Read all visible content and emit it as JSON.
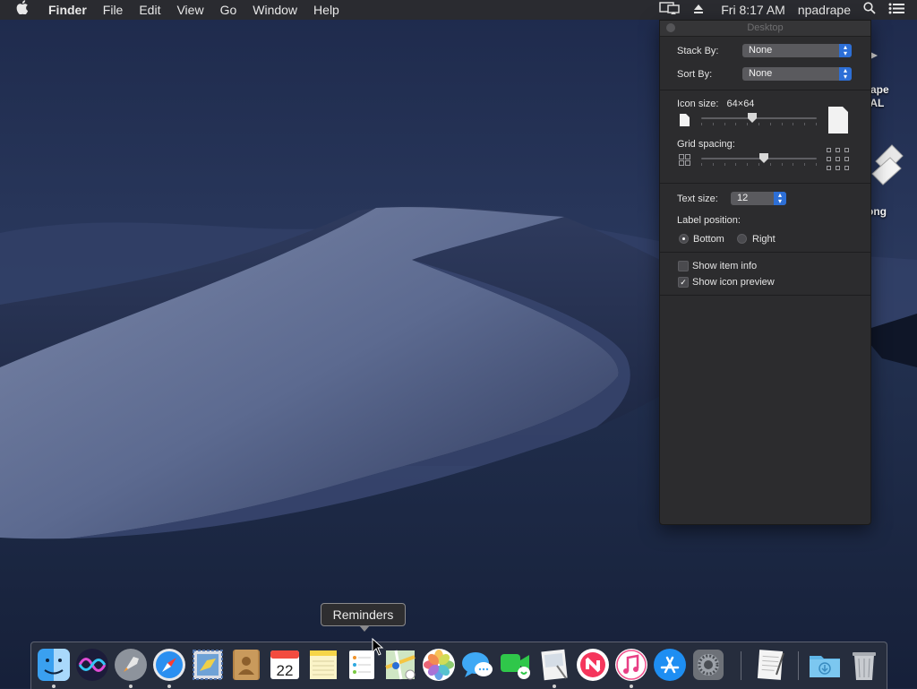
{
  "menubar": {
    "app_name": "Finder",
    "menus": [
      "File",
      "Edit",
      "View",
      "Go",
      "Window",
      "Help"
    ],
    "clock": "Fri 8:17 AM",
    "user": "npadrape"
  },
  "desktop": {
    "label_fragments": [
      "ape",
      "IAL",
      "ong"
    ]
  },
  "view_options": {
    "title": "Desktop",
    "stack_by_label": "Stack By:",
    "stack_by_value": "None",
    "sort_by_label": "Sort By:",
    "sort_by_value": "None",
    "icon_size_label": "Icon size:",
    "icon_size_value": "64×64",
    "icon_size_level": 0.44,
    "grid_spacing_label": "Grid spacing:",
    "grid_spacing_level": 0.54,
    "text_size_label": "Text size:",
    "text_size_value": "12",
    "label_position_label": "Label position:",
    "label_position_options": [
      "Bottom",
      "Right"
    ],
    "label_position_selected": "Bottom",
    "show_item_info_label": "Show item info",
    "show_item_info": false,
    "show_icon_preview_label": "Show icon preview",
    "show_icon_preview": true
  },
  "tooltip": {
    "text": "Reminders"
  },
  "dock": {
    "apps": [
      {
        "name": "finder-icon",
        "running": true
      },
      {
        "name": "siri-icon",
        "running": false
      },
      {
        "name": "launchpad-icon",
        "running": true
      },
      {
        "name": "safari-icon",
        "running": true
      },
      {
        "name": "mail-icon",
        "running": false
      },
      {
        "name": "contacts-icon",
        "running": false
      },
      {
        "name": "calendar-icon",
        "running": false,
        "badge": "22"
      },
      {
        "name": "notes-icon",
        "running": false
      },
      {
        "name": "reminders-icon",
        "running": false
      },
      {
        "name": "maps-icon",
        "running": false
      },
      {
        "name": "photos-icon",
        "running": false
      },
      {
        "name": "messages-icon",
        "running": false
      },
      {
        "name": "facetime-icon",
        "running": false
      },
      {
        "name": "preview-icon",
        "running": true
      },
      {
        "name": "news-icon",
        "running": false
      },
      {
        "name": "music-icon",
        "running": true
      },
      {
        "name": "app-store-icon",
        "running": false
      },
      {
        "name": "system-preferences-icon",
        "running": false
      },
      {
        "name": "textedit-icon",
        "running": false
      },
      {
        "name": "downloads-folder-icon",
        "running": false
      },
      {
        "name": "trash-icon",
        "running": false
      }
    ]
  },
  "colors": {
    "menubar_bg": "#2a2b30",
    "panel_bg": "#2c2c2e",
    "accent": "#2d6fd6"
  }
}
